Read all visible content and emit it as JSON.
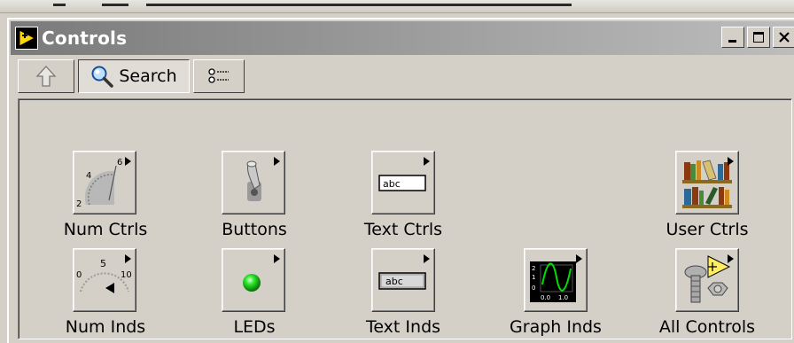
{
  "window": {
    "title": "Controls",
    "minimize_label": "_",
    "close_label": "×"
  },
  "toolbar": {
    "search_label": "Search"
  },
  "palette": {
    "items": [
      {
        "label": "Num Ctrls",
        "icon": "knob-icon"
      },
      {
        "label": "Buttons",
        "icon": "toggle-switch-icon"
      },
      {
        "label": "Text Ctrls",
        "icon": "text-control-icon"
      },
      {
        "label": "User Ctrls",
        "icon": "bookshelf-icon"
      },
      {
        "label": "Num Inds",
        "icon": "meter-icon"
      },
      {
        "label": "LEDs",
        "icon": "led-icon"
      },
      {
        "label": "Text Inds",
        "icon": "text-indicator-icon"
      },
      {
        "label": "Graph Inds",
        "icon": "graph-icon"
      },
      {
        "label": "All Controls",
        "icon": "all-controls-icon"
      }
    ],
    "text_ctrl_sample": "abc",
    "text_ind_sample": "abc",
    "knob_ticks": [
      "2",
      "4",
      "6"
    ],
    "meter_ticks": [
      "0",
      "5",
      "10"
    ],
    "graph_ticks": [
      "2",
      "1",
      "0",
      "0.0",
      "1.0"
    ]
  }
}
